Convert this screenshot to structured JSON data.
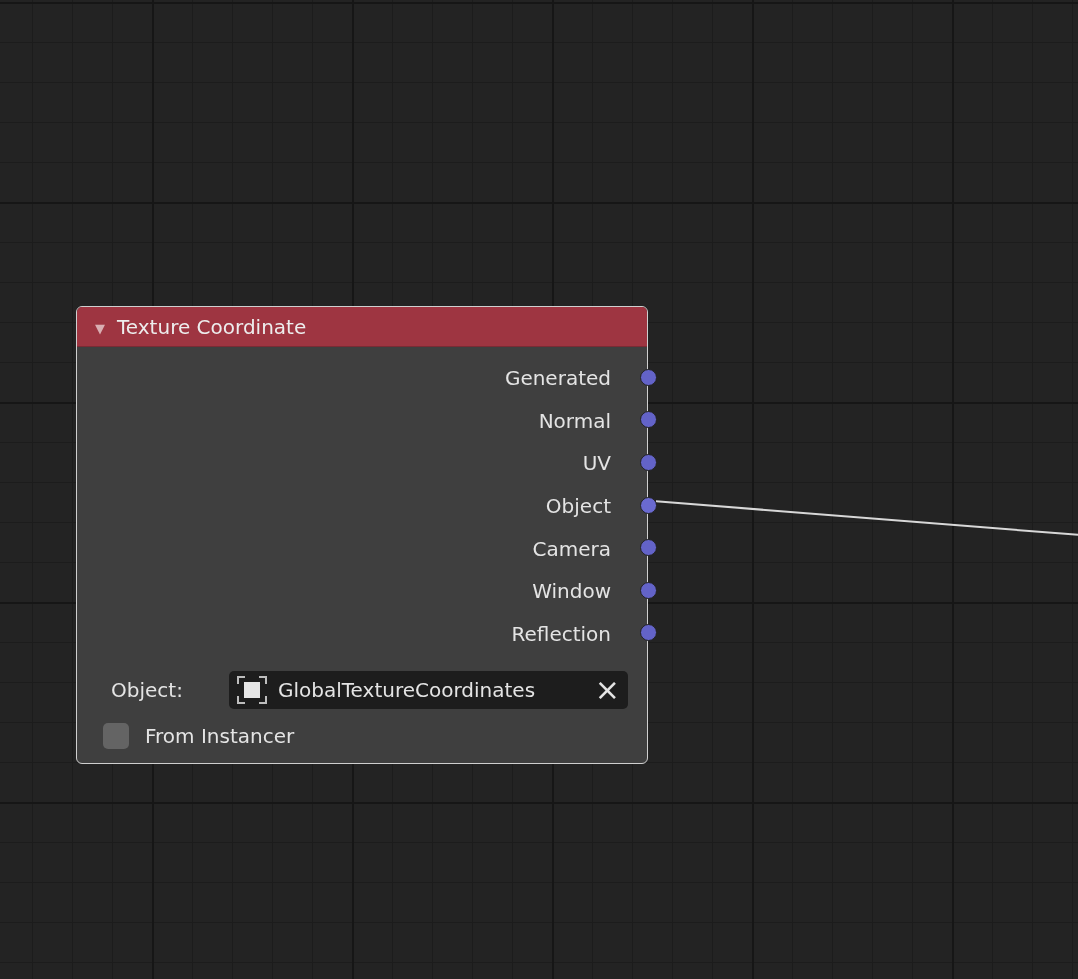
{
  "node": {
    "title": "Texture Coordinate",
    "collapse_icon": "▼",
    "expanded": true,
    "outputs": [
      {
        "label": "Generated",
        "linked": false
      },
      {
        "label": "Normal",
        "linked": false
      },
      {
        "label": "UV",
        "linked": false
      },
      {
        "label": "Object",
        "linked": true
      },
      {
        "label": "Camera",
        "linked": false
      },
      {
        "label": "Window",
        "linked": false
      },
      {
        "label": "Reflection",
        "linked": false
      }
    ],
    "object_field": {
      "label": "Object:",
      "value": "GlobalTextureCoordinates",
      "clear_icon": "×"
    },
    "from_instancer": {
      "label": "From Instancer",
      "checked": false
    }
  }
}
